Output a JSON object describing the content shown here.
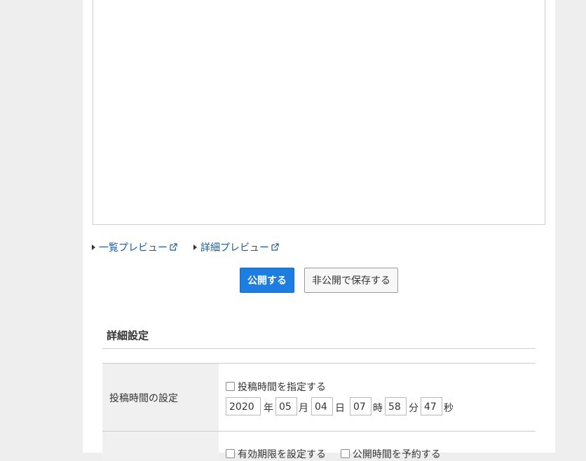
{
  "preview": {
    "list_label": "一覧プレビュー",
    "detail_label": "詳細プレビュー"
  },
  "actions": {
    "publish_label": "公開する",
    "save_private_label": "非公開で保存する",
    "publish_color": "#1e7de0"
  },
  "details": {
    "title": "詳細設定",
    "post_time": {
      "label": "投稿時間の設定",
      "checkbox_label": "投稿時間を指定する",
      "year": "2020",
      "year_unit": "年",
      "month": "05",
      "month_unit": "月",
      "day": "04",
      "day_unit": "日",
      "hour": "07",
      "hour_unit": "時",
      "minute": "58",
      "minute_unit": "分",
      "second": "47",
      "second_unit": "秒"
    },
    "next_row": {
      "checkbox1_label": "有効期限を設定する",
      "checkbox2_label": "公開時間を予約する"
    }
  }
}
